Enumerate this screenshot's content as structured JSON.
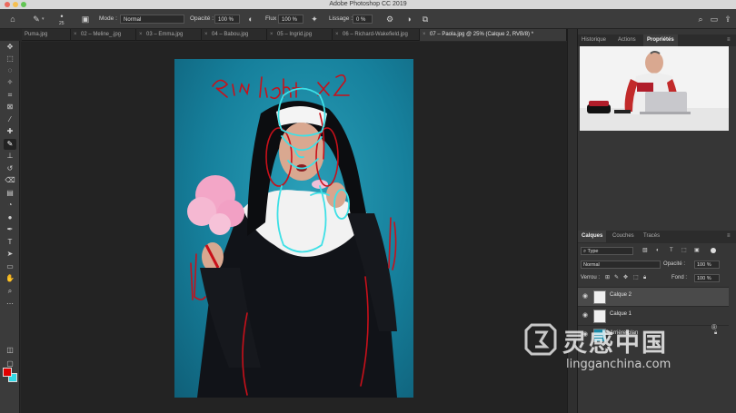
{
  "app": {
    "title": "Adobe Photoshop CC 2019"
  },
  "options_bar": {
    "brush_size": "25",
    "mode_label": "Mode :",
    "mode_value": "Normal",
    "opacity_label": "Opacité :",
    "opacity_value": "100 %",
    "flow_label": "Flux :",
    "flow_value": "100 %",
    "smoothing_label": "Lissage :",
    "smoothing_value": "0 %"
  },
  "doc_tabs": [
    {
      "label": "Puma.jpg"
    },
    {
      "label": "02 – Meline_.jpg"
    },
    {
      "label": "03 – Emma.jpg"
    },
    {
      "label": "04 – Babou.jpg"
    },
    {
      "label": "05 – Ingrid.jpg"
    },
    {
      "label": "06 – Richard-Wakefield.jpg"
    },
    {
      "label": "07 – Paola.jpg @ 25% (Calque 2, RVB/8) *"
    }
  ],
  "canvas": {
    "annotation_text": "Rim light x 2"
  },
  "panels": {
    "top_tabs": [
      "Historique",
      "Actions",
      "Propriétés"
    ],
    "layer_tabs": [
      "Calques",
      "Couches",
      "Tracés"
    ],
    "filter_kind": "Type",
    "blend_mode": "Normal",
    "opacity_label": "Opacité :",
    "opacity_value": "100 %",
    "lock_label": "Verrou :",
    "fill_label": "Fond :",
    "fill_value": "100 %",
    "layers": [
      {
        "name": "Calque 2",
        "selected": true
      },
      {
        "name": "Calque 1",
        "selected": false
      },
      {
        "name": "Arrière-plan",
        "selected": false
      }
    ]
  },
  "colors": {
    "foreground": "#e00000",
    "background": "#33d8e6",
    "drawing_red": "#c8101a",
    "drawing_cyan": "#3ee0e6"
  },
  "watermark": {
    "chinese": "灵感中国",
    "url": "lingganchina.com",
    "registered": "®"
  }
}
